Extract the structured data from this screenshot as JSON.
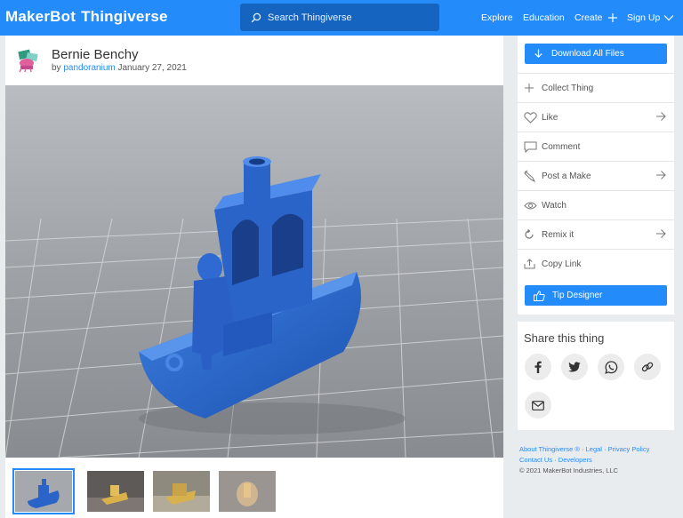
{
  "header": {
    "logo_part1": "MakerBot",
    "logo_part2": "Thingiverse",
    "search_placeholder": "Search Thingiverse",
    "nav": {
      "explore": "Explore",
      "education": "Education",
      "create": "Create",
      "signup": "Sign Up"
    },
    "bg_color": "#248bfb"
  },
  "thing": {
    "title": "Bernie Benchy",
    "by_prefix": "by",
    "author": "pandoranium",
    "date": "January 27, 2021"
  },
  "thumbnails": [
    "thumb-1",
    "thumb-2",
    "thumb-3",
    "thumb-4"
  ],
  "sidebar": {
    "download_all": "Download All Files",
    "actions": {
      "collect": "Collect Thing",
      "like": "Like",
      "comment": "Comment",
      "post_make": "Post a Make",
      "watch": "Watch",
      "remix": "Remix it",
      "copy_link": "Copy Link"
    },
    "tip_designer": "Tip Designer"
  },
  "share": {
    "title": "Share this thing",
    "icons": [
      "facebook-icon",
      "twitter-icon",
      "whatsapp-icon",
      "link-icon",
      "email-icon"
    ]
  },
  "footer": {
    "about": "About Thingiverse ®",
    "sep": "·",
    "legal": "Legal",
    "privacy": "Privacy Policy",
    "contact": "Contact Us",
    "developers": "Developers",
    "copyright": "© 2021 MakerBot Industries, LLC"
  }
}
